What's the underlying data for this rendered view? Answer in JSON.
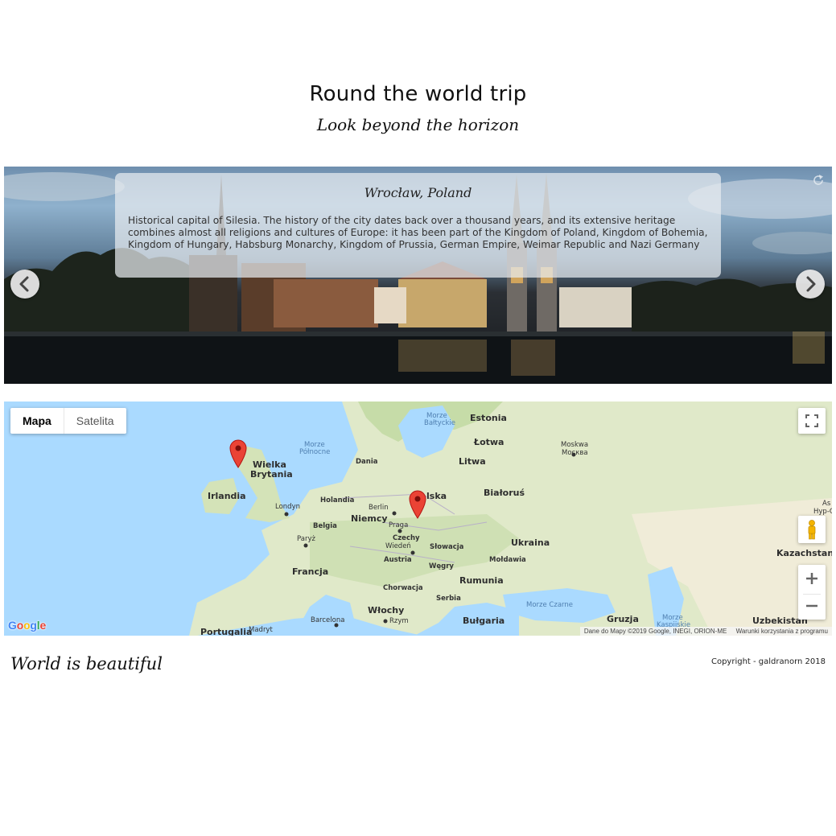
{
  "header": {
    "title": "Round the world trip",
    "subtitle": "Look beyond the horizon"
  },
  "slider": {
    "caption_title": "Wrocław, Poland",
    "caption_text": "Historical capital of Silesia. The history of the city dates back over a thousand years, and its extensive heritage combines almost all religions and cultures of Europe: it has been part of the Kingdom of Poland, Kingdom of Bohemia, Kingdom of Hungary, Habsburg Monarchy, Kingdom of Prussia, German Empire, Weimar Republic and Nazi Germany"
  },
  "map": {
    "type_map": "Mapa",
    "type_satellite": "Satelita",
    "logo": "Google",
    "attribution": "Dane do Mapy ©2019 Google, INEGI, ORION-ME",
    "terms": "Warunki korzystania z programu",
    "labels": {
      "estonia": "Estonia",
      "lotwa": "Łotwa",
      "litwa": "Litwa",
      "bialorus": "Białoruś",
      "ukraina": "Ukraina",
      "kazachstan": "Kazachstan",
      "wielka_brytania_1": "Wielka",
      "wielka_brytania_2": "Brytania",
      "irlandia": "Irlandia",
      "holandia": "Holandia",
      "niemcy": "Niemcy",
      "belgia": "Belgia",
      "czechy": "Czechy",
      "slowacja": "Słowacja",
      "austria": "Austria",
      "wegry": "Węgry",
      "moldawia": "Mołdawia",
      "rumunia": "Rumunia",
      "francja": "Francja",
      "chorwacja": "Chorwacja",
      "serbia": "Serbia",
      "wlochy": "Włochy",
      "bulgaria": "Bułgaria",
      "gruzja": "Gruzja",
      "uzbekistan": "Uzbekistan",
      "portugalia": "Portugalia",
      "polska": "lska",
      "dania": "Dania",
      "londyn": "Londyn",
      "paryz": "Paryż",
      "berlin": "Berlin",
      "praga": "Praga",
      "wieden": "Wiedeń",
      "rzym": "Rzym",
      "barcelona": "Barcelona",
      "madryt": "Madryt",
      "moskwa_1": "Moskwa",
      "moskwa_2": "Москва",
      "morze_baltyckie_1": "Morze",
      "morze_baltyckie_2": "Bałtyckie",
      "morze_polnocne_1": "Morze",
      "morze_polnocne_2": "Północne",
      "morze_czarne": "Morze Czarne",
      "morze_kaspijskie_1": "Morze",
      "morze_kaspijskie_2": "Kaspijskie",
      "asia_edge_1": "As",
      "asia_edge_2": "Hyp-C"
    }
  },
  "footer": {
    "tagline": "World is beautiful",
    "copyright": "Copyright - galdranorn 2018"
  },
  "colors": {
    "water": "#aadaff",
    "land": "#dfe8c8",
    "marker": "#ea4335",
    "caption_bg": "#e8ecf0"
  }
}
